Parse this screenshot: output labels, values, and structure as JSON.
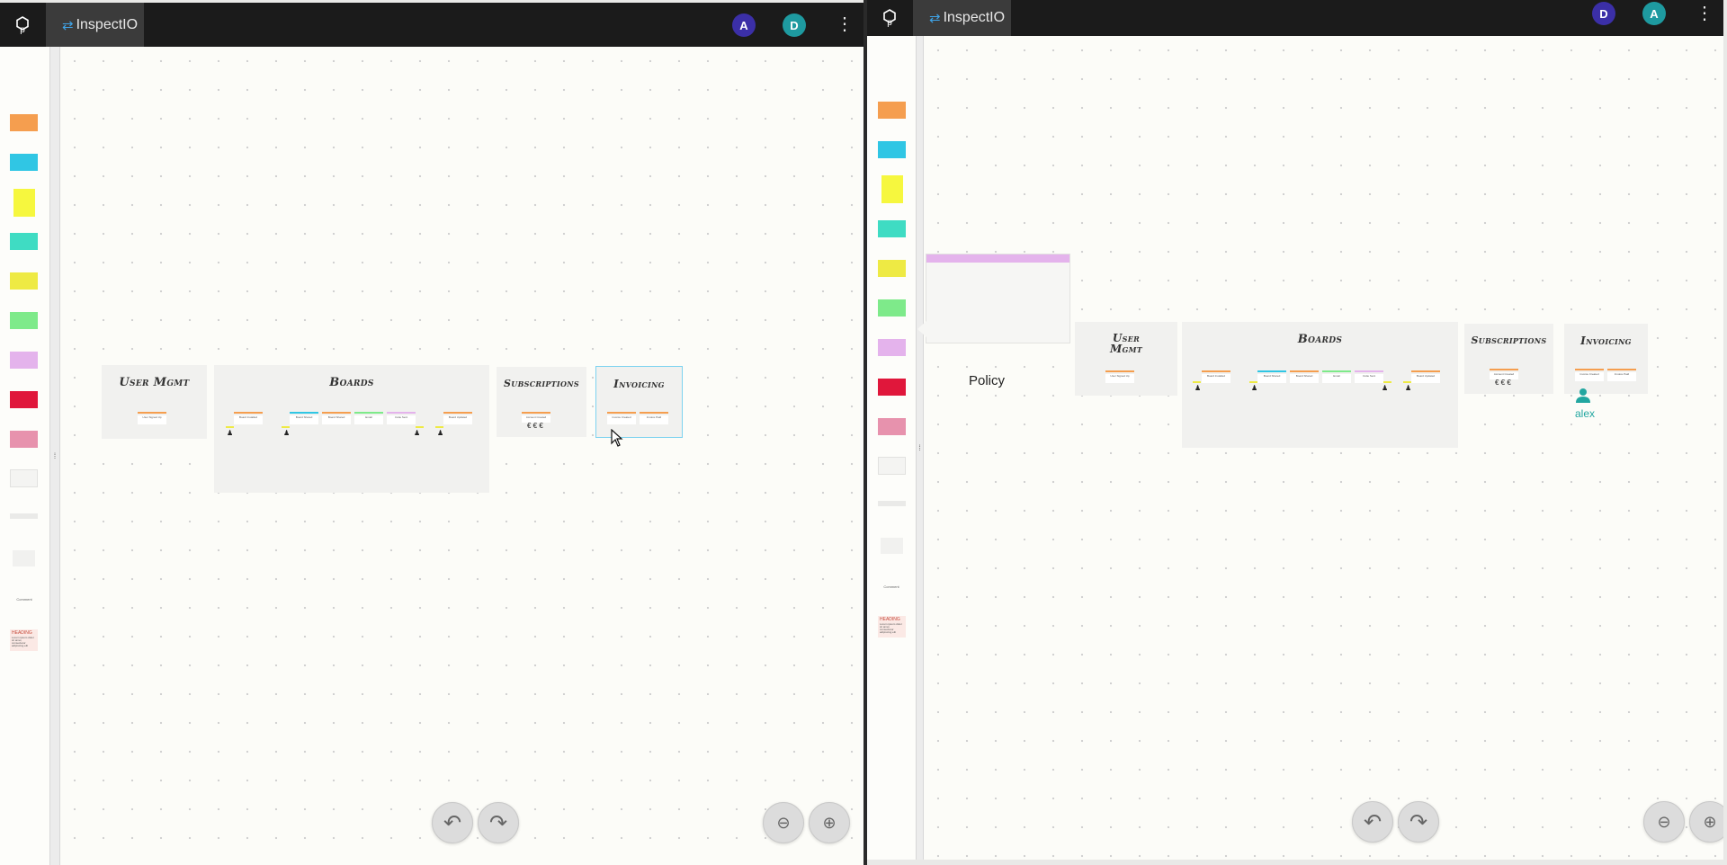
{
  "app": {
    "name": "InspectIO"
  },
  "windows": [
    {
      "tab_label": "InspectIO",
      "logo_letter": "p",
      "avatars": [
        {
          "letter": "A",
          "color": "#3b2fa7"
        },
        {
          "letter": "D",
          "color": "#1e9aa0"
        }
      ],
      "frames": [
        {
          "title": "User Mgmt"
        },
        {
          "title": "Boards"
        },
        {
          "title": "Subscriptions"
        },
        {
          "title": "Invoicing"
        }
      ]
    },
    {
      "tab_label": "InspectIO",
      "logo_letter": "p",
      "avatars": [
        {
          "letter": "D",
          "color": "#3b2fa7"
        },
        {
          "letter": "A",
          "color": "#1e9aa0"
        }
      ],
      "frames": [
        {
          "title": "User Mgmt"
        },
        {
          "title": "Boards"
        },
        {
          "title": "Subscriptions"
        },
        {
          "title": "Invoicing"
        }
      ],
      "policy_label": "Policy",
      "cursor_user": "alex"
    }
  ],
  "palette": {
    "colors": [
      "#f59e4f",
      "#30c6e4",
      "#f6f73e",
      "#3fdcc3",
      "#eeea44",
      "#7eea8a",
      "#e4b3ec",
      "#e0173b",
      "#e792ad",
      "#f4f4f2",
      "#eaeae8",
      "#f1f1ef"
    ],
    "comment_label": "Comment",
    "heading_label": "HEADING",
    "heading_body": "Lorem ipsum dolor sit amet, consectetur adipiscing elit"
  },
  "notes": {
    "user_signed_up": "User Signed Up",
    "board_installed": "Board Installed",
    "board_shared": "Board Shared",
    "email": "Email",
    "invite_sent": "Invite Sent",
    "board_updated": "Board Updated",
    "account_created": "Account Created",
    "invoice_created": "Invoice Created",
    "invoice_paid": "Invoice Paid"
  },
  "controls": {
    "undo_icon": "undo-icon",
    "redo_icon": "redo-icon",
    "zoom_out_icon": "zoom-out-icon",
    "zoom_in_icon": "zoom-in-icon"
  }
}
